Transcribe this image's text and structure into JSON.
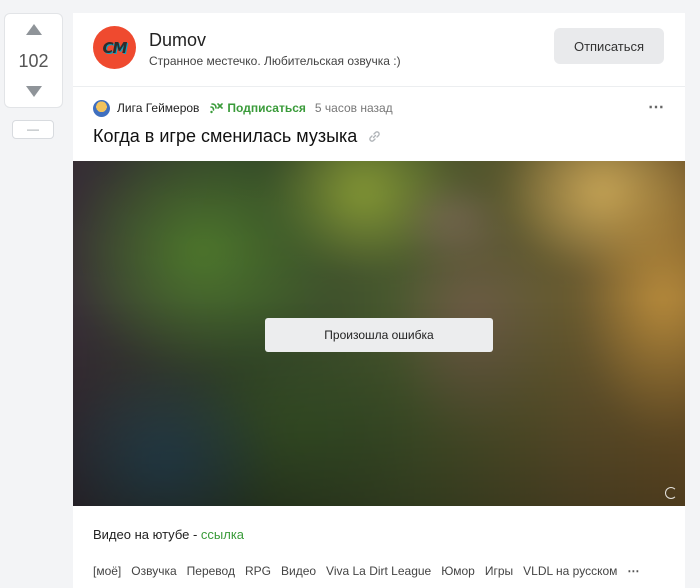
{
  "vote": {
    "count": "102",
    "minus_label": "—"
  },
  "community": {
    "avatar_text": "CM",
    "name": "Dumov",
    "description": "Странное местечко. Любительская озвучка :)",
    "unsubscribe_label": "Отписаться"
  },
  "post": {
    "author": "Лига Геймеров",
    "subscribe_label": "Подписаться",
    "time": "5 часов назад",
    "more_icon": "⋯",
    "title": "Когда в игре сменилась музыка",
    "video_error": "Произошла ошибка",
    "note_prefix": "Видео на ютубе - ",
    "note_link": "ссылка",
    "tags": [
      "[моё]",
      "Озвучка",
      "Перевод",
      "RPG",
      "Видео",
      "Viva La Dirt League",
      "Юмор",
      "Игры",
      "VLDL на русском"
    ],
    "tags_more": "⋯"
  },
  "colors": {
    "accent_green": "#3a9b3a",
    "community_avatar": "#ef4a2f"
  },
  "icons": {
    "vote_up": "triangle-up-icon",
    "vote_down": "triangle-down-icon",
    "subscribe": "subscribe-icon",
    "link": "link-icon",
    "more": "more-dots-icon"
  }
}
